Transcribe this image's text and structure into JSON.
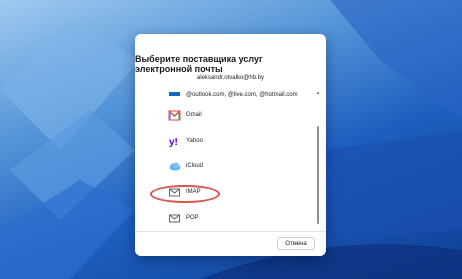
{
  "dialog": {
    "title": "Выберите поставщика услуг электронной почты",
    "account_email": "aleksandr.otvalko@hb.by"
  },
  "providers": [
    {
      "label": "@outlook.com, @live.com, @hotmail.com",
      "icon": "outlook-icon"
    },
    {
      "label": "Gmail",
      "icon": "gmail-icon"
    },
    {
      "label": "Yahoo",
      "icon": "yahoo-icon"
    },
    {
      "label": "iCloud",
      "icon": "icloud-icon"
    },
    {
      "label": "IMAP",
      "icon": "mail-icon"
    },
    {
      "label": "POP",
      "icon": "mail-icon"
    }
  ],
  "buttons": {
    "cancel": "Отмена"
  },
  "colors": {
    "highlight": "#d9534f",
    "dialog_bg": "#ffffff"
  }
}
